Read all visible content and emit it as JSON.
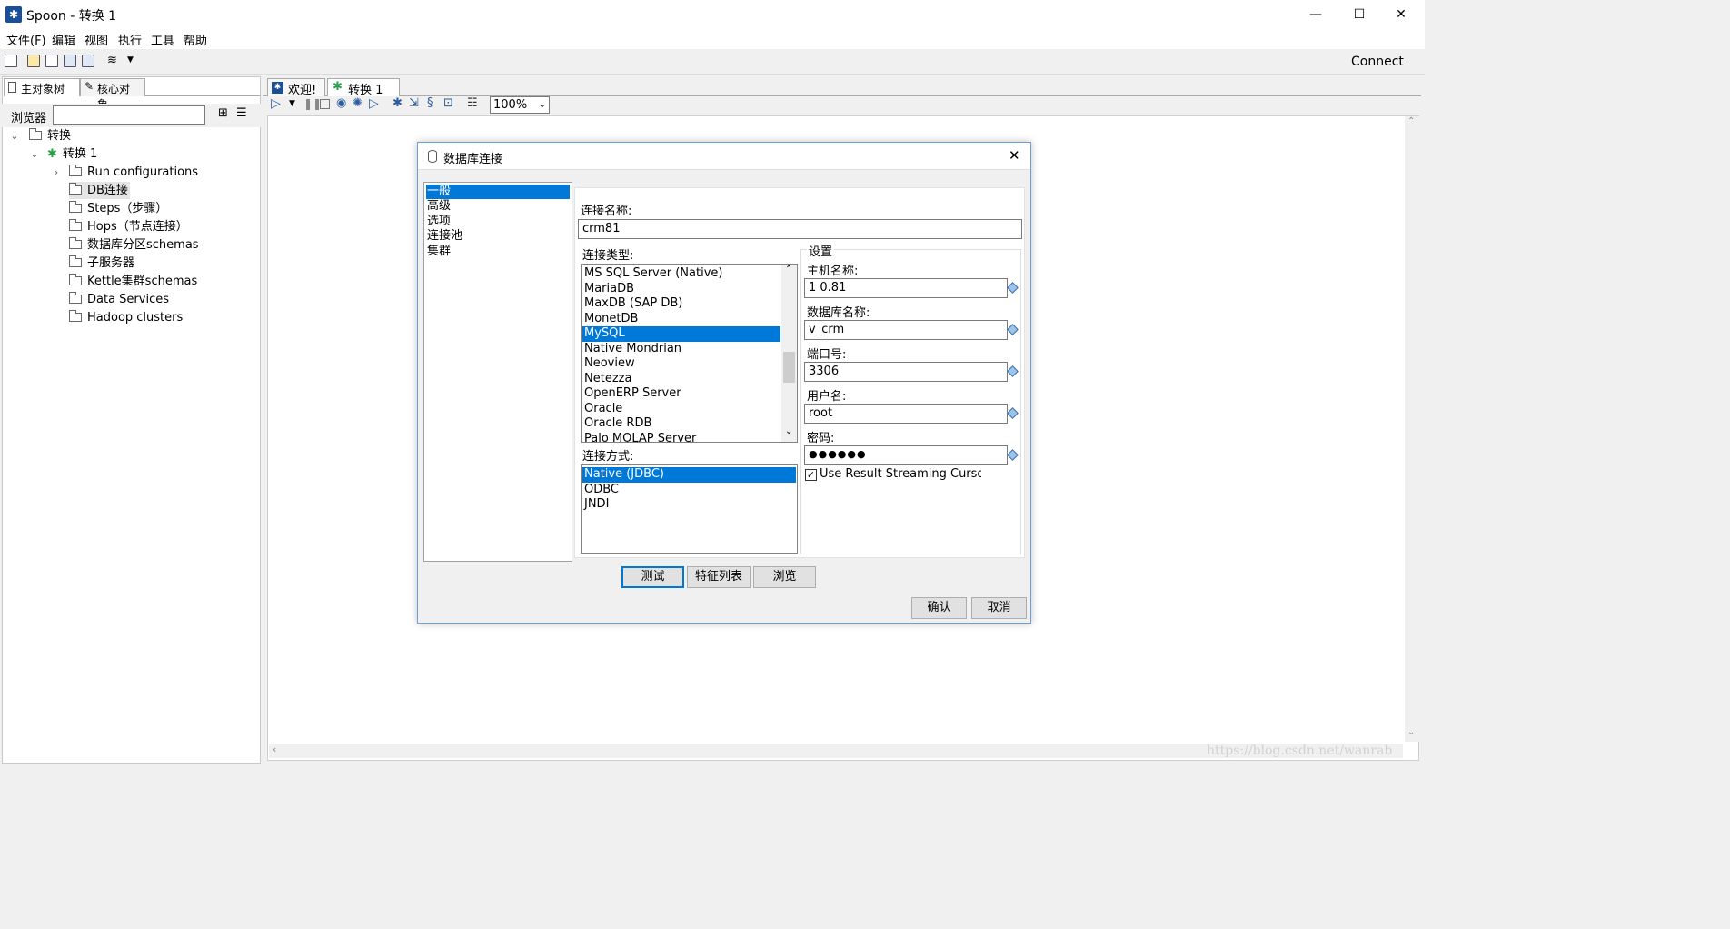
{
  "window": {
    "title": "Spoon - 转换 1",
    "min_glyph": "—",
    "max_glyph": "☐",
    "close_glyph": "✕"
  },
  "menu": [
    "文件(F)",
    "编辑",
    "视图",
    "执行",
    "工具",
    "帮助"
  ],
  "toolbar": {
    "connect_label": "Connect"
  },
  "left_panel": {
    "tabs": [
      "主对象树",
      "核心对象"
    ],
    "browser_label": "浏览器",
    "tree": {
      "root": "转换",
      "trans": "转换 1",
      "items": [
        "Run configurations",
        "DB连接",
        "Steps（步骤）",
        "Hops（节点连接）",
        "数据库分区schemas",
        "子服务器",
        "Kettle集群schemas",
        "Data Services",
        "Hadoop clusters"
      ]
    }
  },
  "tabs": [
    {
      "label": "欢迎!"
    },
    {
      "label": "转换 1"
    }
  ],
  "zoom": "100%",
  "dialog": {
    "title": "数据库连接",
    "categories": [
      "一般",
      "高级",
      "选项",
      "连接池",
      "集群"
    ],
    "conn_name_label": "连接名称:",
    "conn_name_value": "crm81",
    "conn_type_label": "连接类型:",
    "conn_types": [
      "MS SQL Server (Native)",
      "MariaDB",
      "MaxDB (SAP DB)",
      "MonetDB",
      "MySQL",
      "Native Mondrian",
      "Neoview",
      "Netezza",
      "OpenERP Server",
      "Oracle",
      "Oracle RDB",
      "Palo MOLAP Server"
    ],
    "access_label": "连接方式:",
    "access_types": [
      "Native (JDBC)",
      "ODBC",
      "JNDI"
    ],
    "settings_label": "设置",
    "host_label": "主机名称:",
    "host_value": "1          0.81",
    "db_label": "数据库名称:",
    "db_value": "    v_crm",
    "port_label": "端口号:",
    "port_value": "3306",
    "user_label": "用户名:",
    "user_value": "root",
    "pass_label": "密码:",
    "pass_value": "●●●●●●",
    "streaming_label": "Use Result Streaming Cursor",
    "buttons": {
      "test": "测试",
      "features": "特征列表",
      "explore": "浏览",
      "ok": "确认",
      "cancel": "取消"
    }
  },
  "watermark": "https://blog.csdn.net/wanrab"
}
